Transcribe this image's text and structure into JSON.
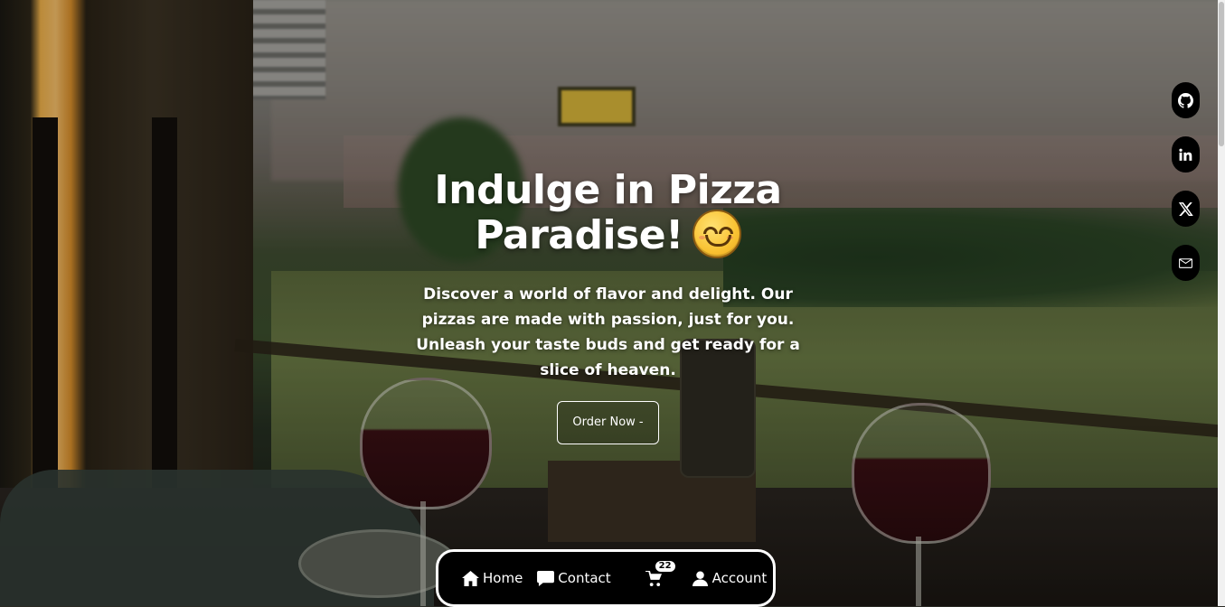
{
  "hero": {
    "title_line1": "Indulge in Pizza",
    "title_line2": "Paradise!",
    "emoji": "smiling-face-icon",
    "description": "Discover a world of flavor and delight. Our pizzas are made with passion, just for you. Unleash your taste buds and get ready for a slice of heaven.",
    "order_button": "Order Now -"
  },
  "social": [
    {
      "name": "github-icon"
    },
    {
      "name": "linkedin-icon"
    },
    {
      "name": "x-icon"
    },
    {
      "name": "mail-icon"
    }
  ],
  "nav": {
    "home": "Home",
    "contact": "Contact",
    "cart_count": "22",
    "account": "Account"
  }
}
